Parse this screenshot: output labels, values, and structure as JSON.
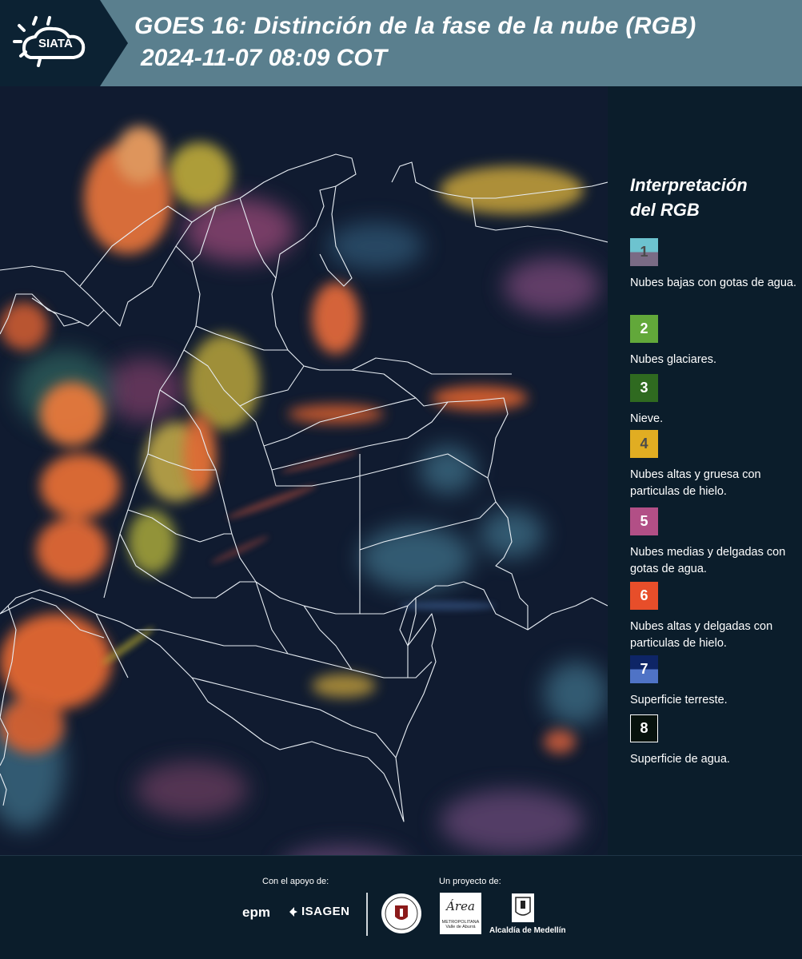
{
  "header": {
    "logo_text": "SIATA",
    "title_line1": "GOES 16: Distinción de la fase de la nube (RGB)",
    "title_line2": "2024-11-07 08:09 COT"
  },
  "legend": {
    "title_line1": "Interpretación",
    "title_line2": "del RGB",
    "items": [
      {
        "number": "1",
        "colors": [
          "#6dc3cf",
          "#7a6b85"
        ],
        "text_color": "#4b4b4b",
        "description": "Nubes bajas con gotas de agua."
      },
      {
        "number": "2",
        "colors": [
          "#62a83a"
        ],
        "text_color": "#ffffff",
        "description": "Nubes glaciares."
      },
      {
        "number": "3",
        "colors": [
          "#2f6a20"
        ],
        "text_color": "#ffffff",
        "description": "Nieve."
      },
      {
        "number": "4",
        "colors": [
          "#e1ad22"
        ],
        "text_color": "#4b4b4b",
        "description": "Nubes altas y gruesa con particulas de hielo."
      },
      {
        "number": "5",
        "colors": [
          "#b24f86"
        ],
        "text_color": "#ffffff",
        "description": "Nubes medias y delgadas con gotas de agua."
      },
      {
        "number": "6",
        "colors": [
          "#e74e2a"
        ],
        "text_color": "#ffffff",
        "description": "Nubes altas y delgadas con particulas de hielo."
      },
      {
        "number": "7",
        "colors": [
          "#0e2566",
          "#4f73c6"
        ],
        "text_color": "#ffffff",
        "description": "Superficie terreste."
      },
      {
        "number": "8",
        "colors": [
          "#07120d"
        ],
        "text_color": "#ffffff",
        "description": "Superficie de agua."
      }
    ]
  },
  "footer": {
    "support_label": "Con el apoyo de:",
    "project_label": "Un proyecto de:",
    "sponsor_1": "epm",
    "sponsor_2": "ISAGEN",
    "partner_2_title": "Área",
    "partner_2_subtitle": "METROPOLITANA Valle de Aburrá",
    "partner_3": "Alcaldía de Medellín"
  }
}
